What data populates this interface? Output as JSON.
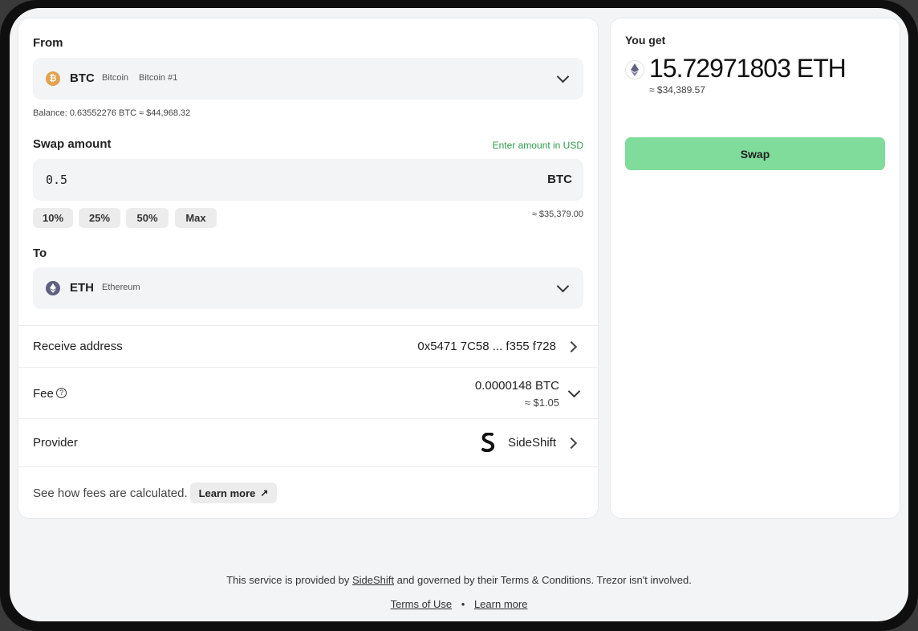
{
  "from": {
    "label": "From",
    "symbol": "BTC",
    "name": "Bitcoin",
    "account": "Bitcoin #1",
    "balance": "Balance: 0.63552276 BTC ≈ $44,968.32"
  },
  "amount": {
    "label": "Swap amount",
    "usd_toggle": "Enter amount in USD",
    "value": "0.5",
    "unit": "BTC",
    "usd_equiv": "≈ $35,379.00",
    "presets": [
      "10%",
      "25%",
      "50%",
      "Max"
    ]
  },
  "to": {
    "label": "To",
    "symbol": "ETH",
    "name": "Ethereum"
  },
  "receive": {
    "label": "Receive address",
    "value": "0x5471 7C58 ... f355 f728"
  },
  "fee": {
    "label": "Fee",
    "value": "0.0000148 BTC",
    "usd": "≈ $1.05"
  },
  "provider": {
    "label": "Provider",
    "name": "SideShift"
  },
  "fees_note": {
    "text": "See how fees are calculated.",
    "button": "Learn more"
  },
  "summary": {
    "label": "You get",
    "amount": "15.72971803 ETH",
    "usd": "≈ $34,389.57",
    "swap_button": "Swap"
  },
  "footer": {
    "pre": "This service is provided by",
    "provider_link": "SideShift",
    "post": "and governed by their Terms & Conditions. Trezor isn't involved.",
    "terms_link": "Terms of Use",
    "separator": "•",
    "learn_link": "Learn more"
  },
  "colors": {
    "btc": "#e2a24f",
    "eth": "#5f6180",
    "swap_button": "#7fdc9b",
    "accent_green": "#2e9b4a"
  },
  "icons": [
    "bitcoin-icon",
    "ethereum-icon",
    "chevron-down-icon",
    "chevron-right-icon",
    "help-circle-icon",
    "sideshift-logo-icon",
    "external-link-icon"
  ]
}
